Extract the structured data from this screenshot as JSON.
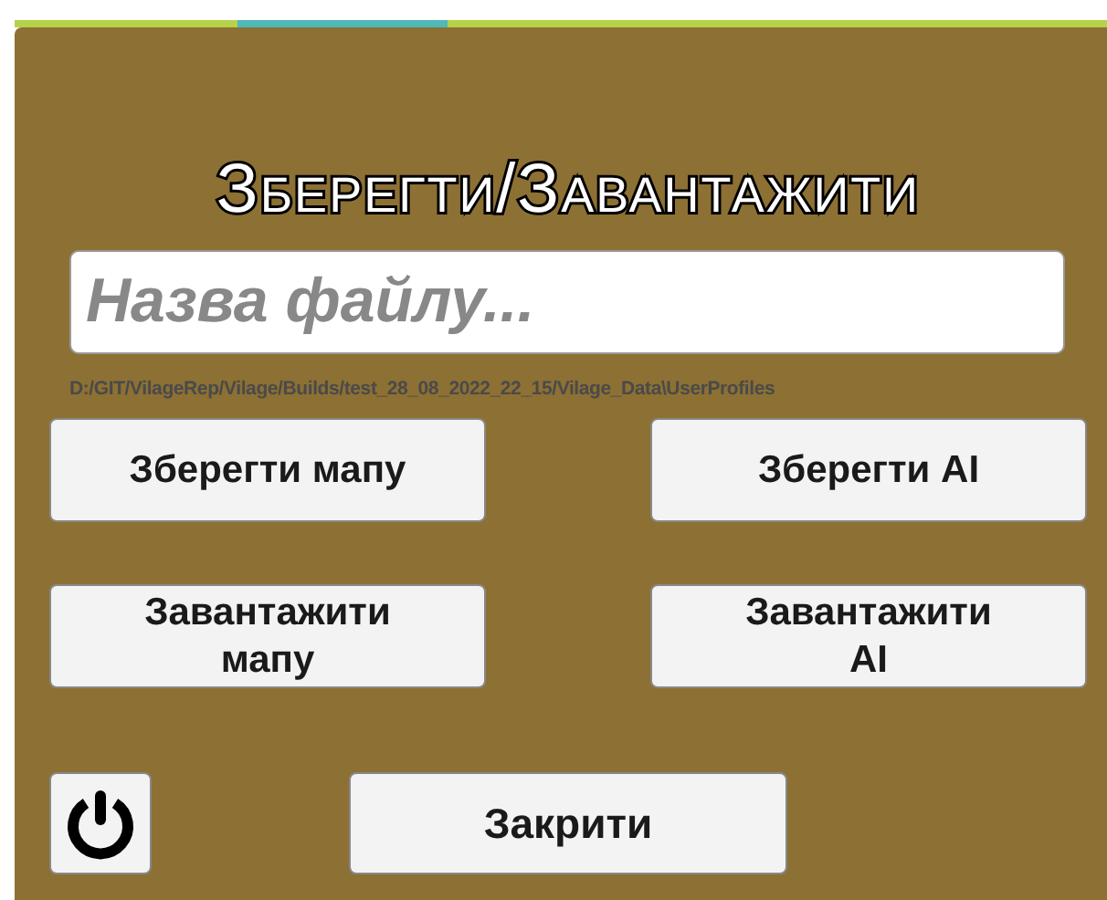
{
  "dialog": {
    "title": "Зберегти/Завантажити",
    "filename_field": {
      "placeholder": "Назва файлу..."
    },
    "save_path": "D:/GIT/VilageRep/Vilage/Builds/test_28_08_2022_22_15/Vilage_Data\\UserProfiles",
    "buttons": [
      {
        "label": "Зберегти мапу"
      },
      {
        "label": "Зберегти AI"
      },
      {
        "label": "Завантажити мапу"
      },
      {
        "label": "Завантажити AI"
      }
    ],
    "close_button": "Закрити"
  }
}
